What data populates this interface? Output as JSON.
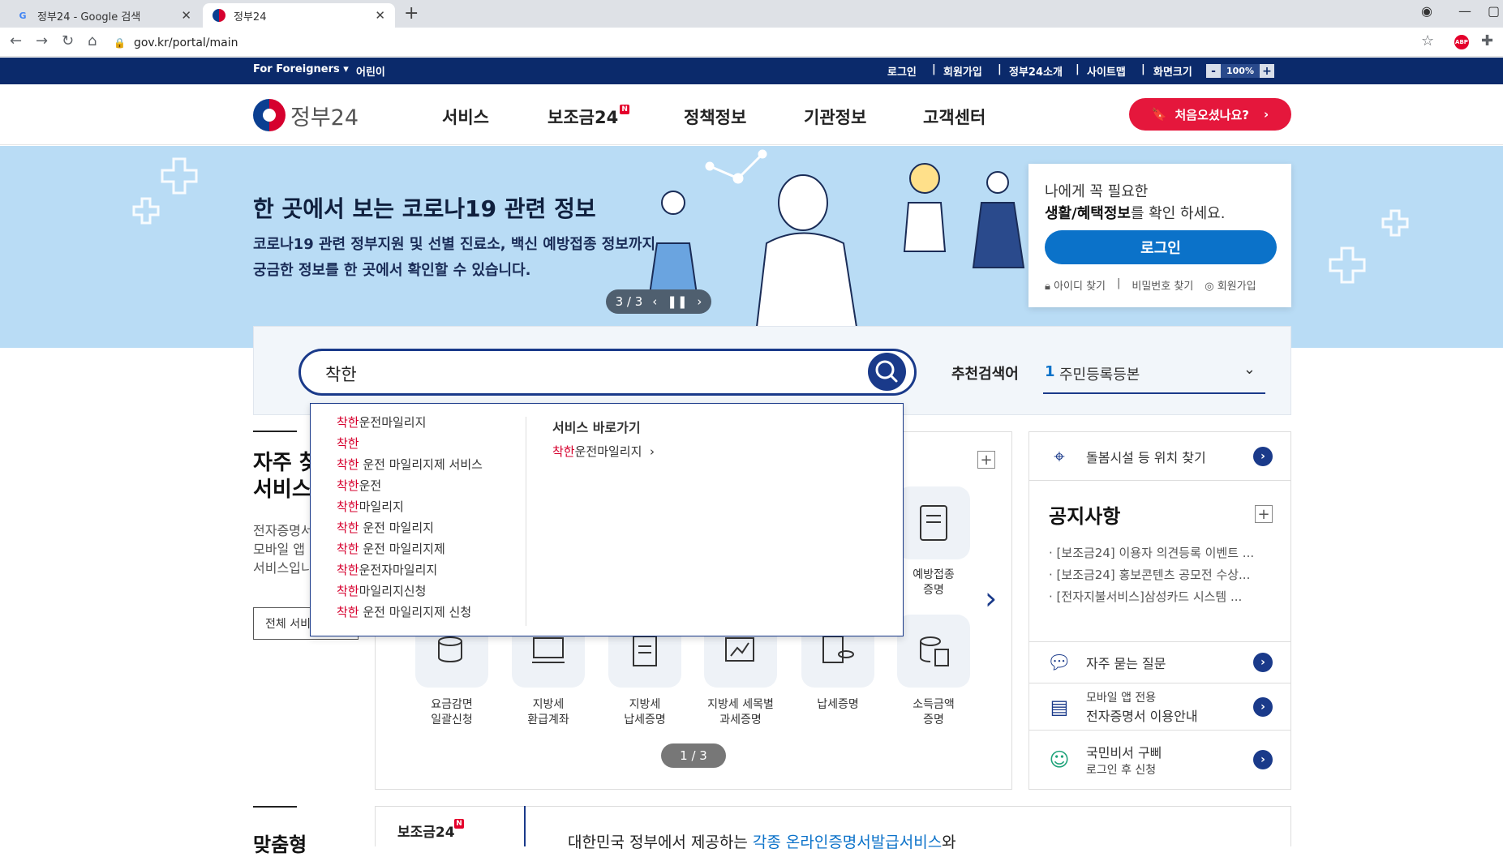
{
  "browser": {
    "tabs": [
      {
        "label": "정부24 - Google 검색"
      },
      {
        "label": "정부24"
      }
    ],
    "url": "gov.kr/portal/main"
  },
  "topbar": {
    "foreigners": "For Foreigners ▾",
    "kids": "어린이",
    "login": "로그인",
    "signup": "회원가입",
    "about": "정부24소개",
    "sitemap": "사이트맵",
    "screensize": "화면크기",
    "zoom_minus": "-",
    "zoom_value": "100%",
    "zoom_plus": "+"
  },
  "header": {
    "logo_text": "정부24",
    "nav": [
      "서비스",
      "보조금24",
      "정책정보",
      "기관정보",
      "고객센터"
    ],
    "nav_badge": "N",
    "first_visit_button": "처음오셨나요?"
  },
  "banner": {
    "title": "한 곳에서 보는 코로나19 관련 정보",
    "desc_line1": "코로나19 관련 정부지원 및 선별 진료소, 백신 예방접종 정보까지",
    "desc_line2": "궁금한 정보를 한 곳에서 확인할 수 있습니다.",
    "slide_counter": "3 / 3"
  },
  "login_panel": {
    "line1": "나에게 꼭 필요한",
    "line2_bold": "생활/혜택정보",
    "line2_rest": "를 확인 하세요.",
    "login_button": "로그인",
    "find_id": "아이디 찾기",
    "find_pw": "비밀번호 찾기",
    "signup": "회원가입"
  },
  "search": {
    "value": "착한",
    "recommended_label": "추천검색어",
    "recommended_num": "1",
    "recommended_item": "주민등록등본"
  },
  "autocomplete": {
    "suggestions": [
      {
        "hl": "착한",
        "rest": "운전마일리지"
      },
      {
        "hl": "착한",
        "rest": ""
      },
      {
        "hl": "착한",
        "rest": " 운전 마일리지제 서비스"
      },
      {
        "hl": "착한",
        "rest": "운전"
      },
      {
        "hl": "착한",
        "rest": "마일리지"
      },
      {
        "hl": "착한",
        "rest": " 운전 마일리지"
      },
      {
        "hl": "착한",
        "rest": " 운전 마일리지제"
      },
      {
        "hl": "착한",
        "rest": "운전자마일리지"
      },
      {
        "hl": "착한",
        "rest": "마일리지신청"
      },
      {
        "hl": "착한",
        "rest": " 운전 마일리지제 신청"
      }
    ],
    "right_title": "서비스 바로가기",
    "right_link_hl": "착한",
    "right_link_rest": "운전마일리지  ›"
  },
  "frequent": {
    "title_line1": "자주 찾",
    "title_line2": "서비스",
    "desc_line1": "전자증명서",
    "desc_line2": "모바일 앱",
    "desc_line3": "서비스입니",
    "all_button": "전체 서비"
  },
  "services": {
    "top_right": {
      "label_line1": "예방접종",
      "label_line2": "증명"
    },
    "items": [
      {
        "line1": "요금감면",
        "line2": "일괄신청"
      },
      {
        "line1": "지방세",
        "line2": "환급계좌"
      },
      {
        "line1": "지방세",
        "line2": "납세증명"
      },
      {
        "line1": "지방세 세목별",
        "line2": "과세증명"
      },
      {
        "line1": "납세증명",
        "line2": ""
      },
      {
        "line1": "소득금액",
        "line2": "증명"
      }
    ],
    "pager": "1 / 3"
  },
  "sidebar": {
    "care": "돌봄시설 등 위치 찾기",
    "notice_title": "공지사항",
    "notices": [
      "[보조금24] 이용자 의견등록 이벤트 ...",
      "[보조금24] 홍보콘텐츠 공모전 수상...",
      "[전자지불서비스]삼성카드 시스템 ..."
    ],
    "faq": "자주 묻는 질문",
    "mobile_line1": "모바일 앱 전용",
    "mobile_line2": "전자증명서 이용안내",
    "secretary_line1": "국민비서 구삐",
    "secretary_line2": "로그인 후 신청"
  },
  "bottom": {
    "left_title": "맞춤형",
    "tab_label": "보조금24",
    "tab_badge": "N",
    "text_pre": "대한민국 정부에서 제공하는 ",
    "text_em": "각종 온라인증명서발급서비스",
    "text_post": "와"
  }
}
